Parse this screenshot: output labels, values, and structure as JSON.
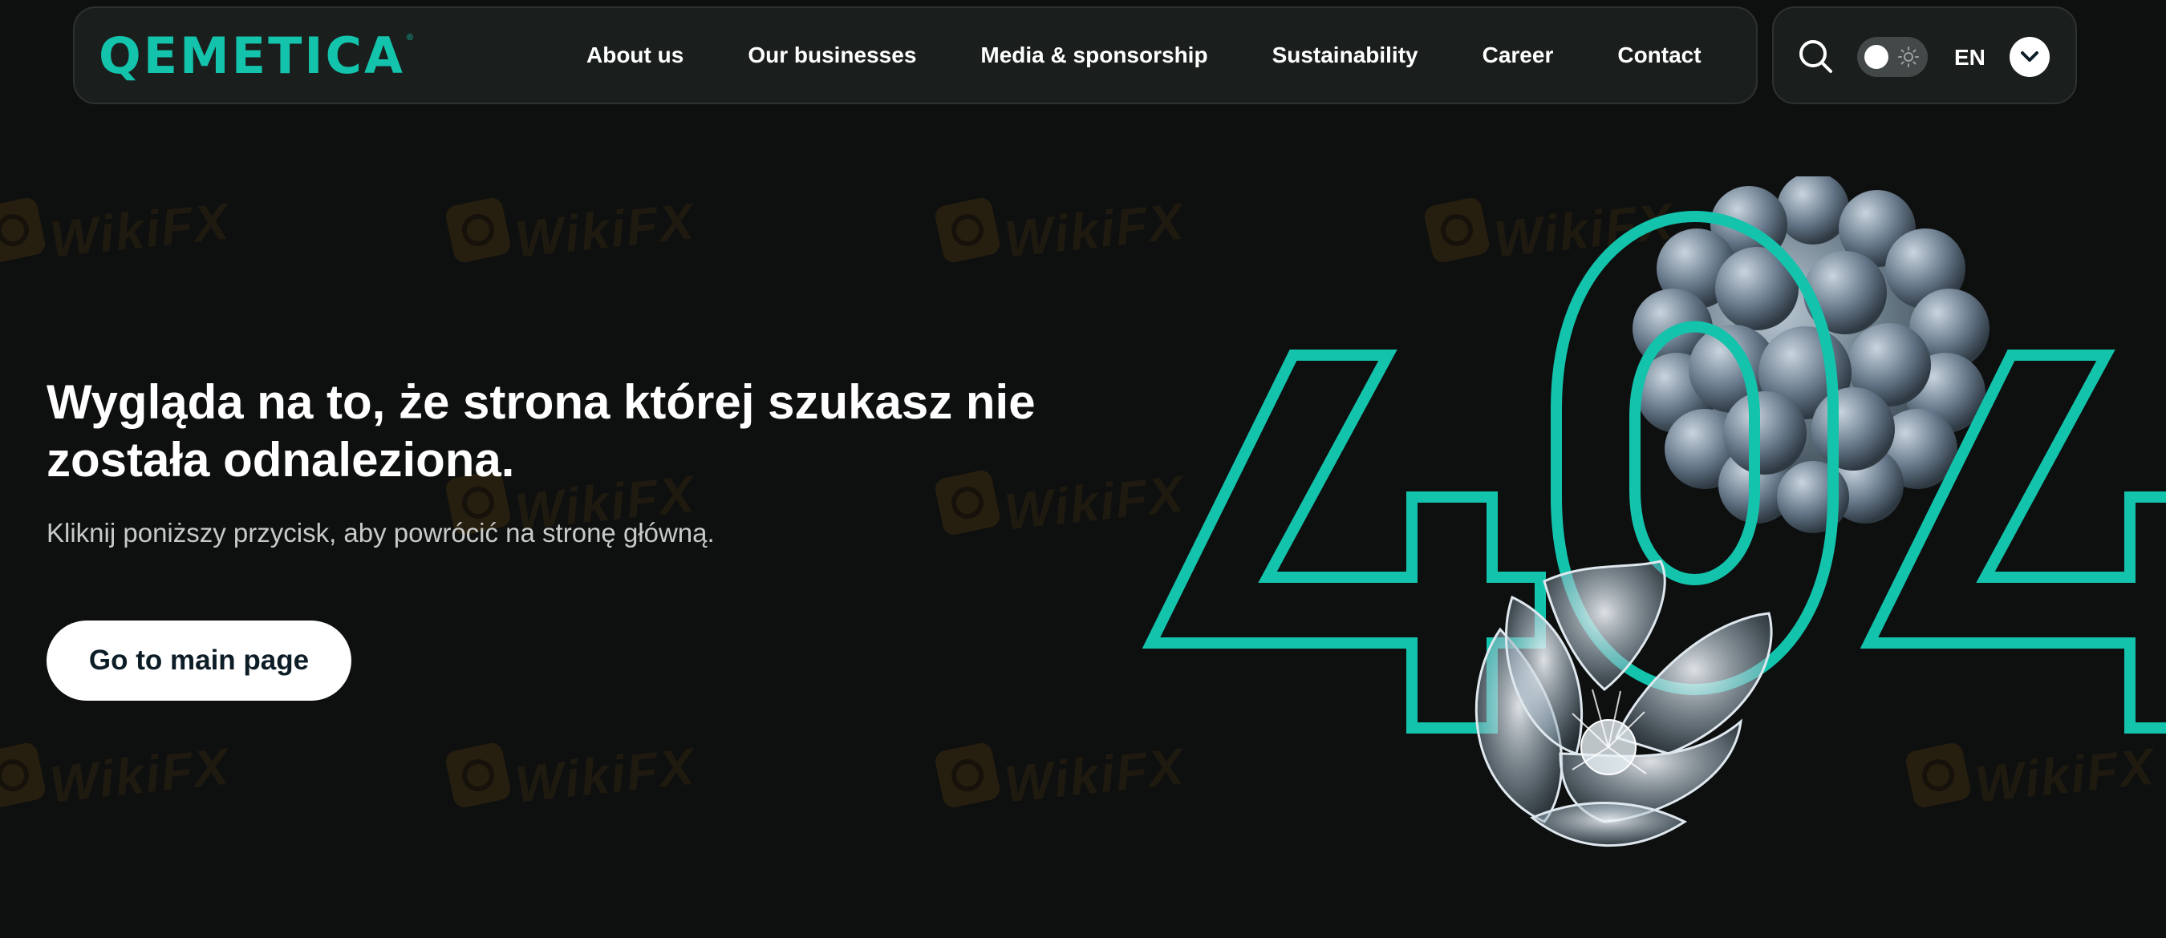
{
  "header": {
    "logo_text": "QEMETICA",
    "logo_mark": "®",
    "menu": [
      {
        "label": "About us"
      },
      {
        "label": "Our businesses"
      },
      {
        "label": "Media & sponsorship"
      },
      {
        "label": "Sustainability"
      },
      {
        "label": "Career"
      },
      {
        "label": "Contact"
      }
    ],
    "tools": {
      "search_icon": "search-icon",
      "theme_toggle": "theme-toggle",
      "language": "EN",
      "language_icon": "chevron-down-icon"
    }
  },
  "hero": {
    "headline": "Wygląda na to, że strona której szukasz nie została odnaleziona.",
    "subline": "Kliknij poniższy przycisk, aby powrócić na stronę główną.",
    "cta_label": "Go to main page"
  },
  "illustration": {
    "digits": "404"
  },
  "watermark": {
    "text": "WikiFX"
  },
  "colors": {
    "background": "#0e0f0f",
    "accent": "#13c3ac",
    "nav_bg": "#1a1e1d",
    "button_bg": "#ffffff",
    "button_text": "#0d1d27"
  }
}
